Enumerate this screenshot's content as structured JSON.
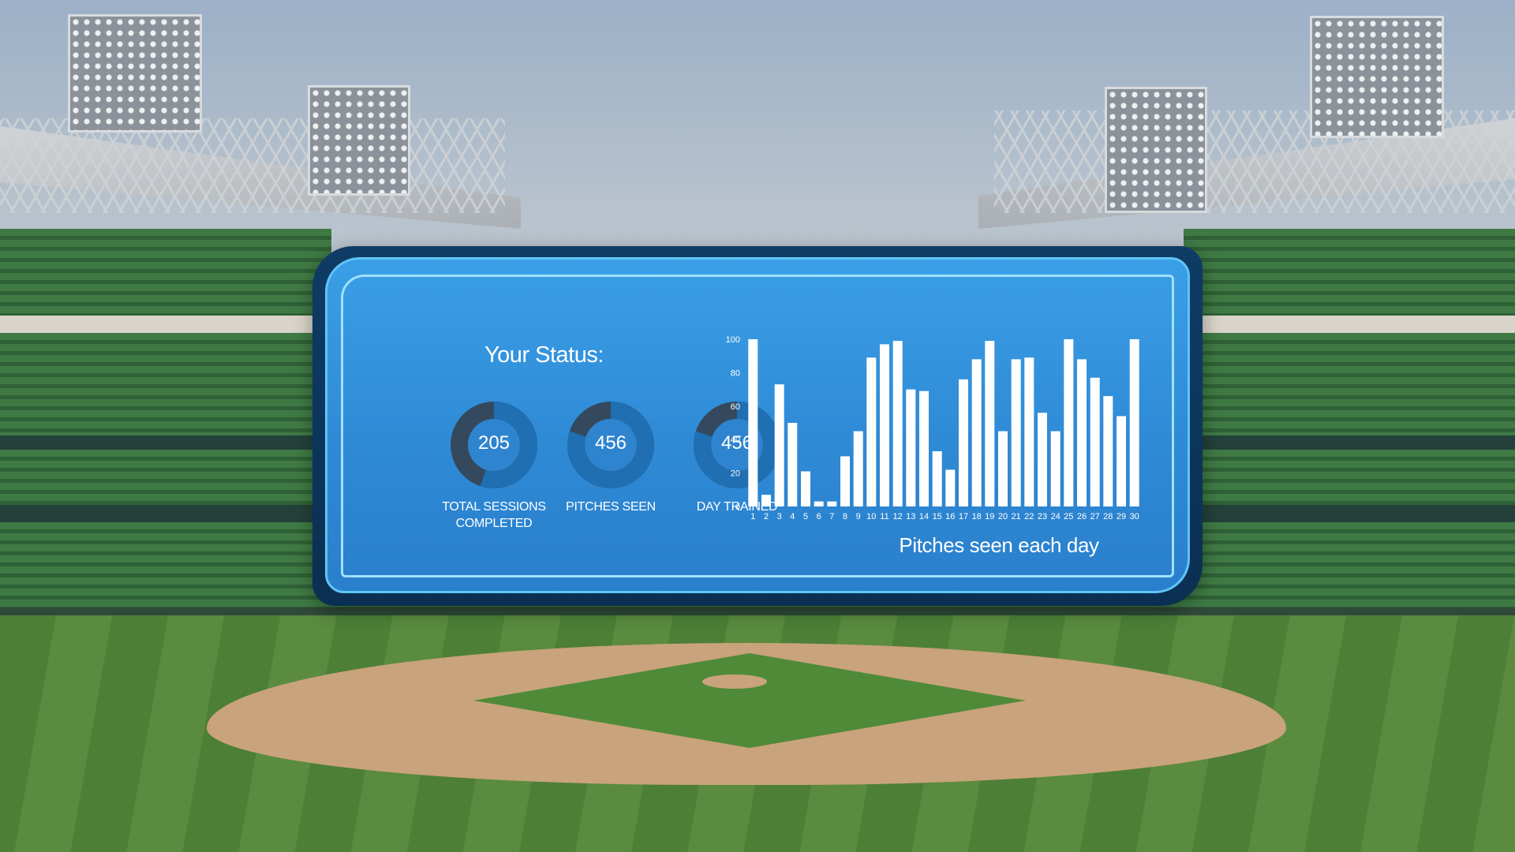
{
  "status": {
    "title": "Your Status:",
    "stats": [
      {
        "value": "205",
        "label_line1": "TOTAL SESSIONS",
        "label_line2": "COMPLETED",
        "fill": 0.55
      },
      {
        "value": "456",
        "label_line1": "PITCHES SEEN",
        "label_line2": "",
        "fill": 0.8
      },
      {
        "value": "456",
        "label_line1": "DAY TRAINED",
        "label_line2": "",
        "fill": 0.8
      }
    ]
  },
  "colors": {
    "panel_blue": "#2f8ad6",
    "panel_border": "#0b2f52",
    "frame_line": "#9fe1ff",
    "donut_track": "#34495e",
    "donut_fill": "#1f6fb2",
    "bar": "#ffffff"
  },
  "chart_data": {
    "type": "bar",
    "title": "Pitches seen each day",
    "xlabel": "",
    "ylabel": "",
    "ylim": [
      0,
      100
    ],
    "yticks": [
      "0",
      "20",
      "40",
      "60",
      "80",
      "100"
    ],
    "categories": [
      "1",
      "2",
      "3",
      "4",
      "5",
      "6",
      "7",
      "8",
      "9",
      "10",
      "11",
      "12",
      "13",
      "14",
      "15",
      "16",
      "17",
      "18",
      "19",
      "20",
      "21",
      "22",
      "23",
      "24",
      "25",
      "26",
      "27",
      "28",
      "29",
      "30"
    ],
    "values": [
      100,
      7,
      73,
      50,
      21,
      3,
      3,
      30,
      45,
      89,
      97,
      99,
      70,
      69,
      33,
      22,
      76,
      88,
      99,
      45,
      88,
      89,
      56,
      45,
      100,
      88,
      77,
      66,
      54,
      100
    ],
    "grid": false,
    "legend": "none"
  }
}
